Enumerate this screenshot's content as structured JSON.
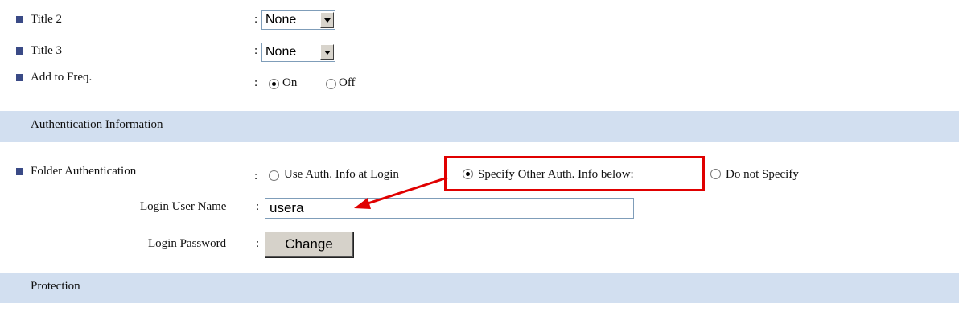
{
  "rows": {
    "title2": {
      "label": "Title 2",
      "sep": ":",
      "value": "None"
    },
    "title3": {
      "label": "Title 3",
      "sep": ":",
      "value": "None"
    },
    "add_to_freq": {
      "label": "Add to Freq.",
      "sep": ":",
      "options": [
        "On",
        "Off"
      ],
      "selected": "On"
    }
  },
  "sections": {
    "auth": "Authentication Information",
    "protection": "Protection"
  },
  "folder_auth": {
    "label": "Folder Authentication",
    "sep": ":",
    "options": [
      "Use Auth. Info at Login",
      "Specify Other Auth. Info below:",
      "Do not Specify"
    ],
    "selected": "Specify Other Auth. Info below:"
  },
  "login_user": {
    "label": "Login User Name",
    "sep": ":",
    "value": "usera"
  },
  "login_password": {
    "label": "Login Password",
    "sep": ":",
    "button": "Change"
  },
  "colors": {
    "section_bar": "#d2dff0",
    "bullet": "#3a4a86",
    "annotation": "#e00000"
  }
}
